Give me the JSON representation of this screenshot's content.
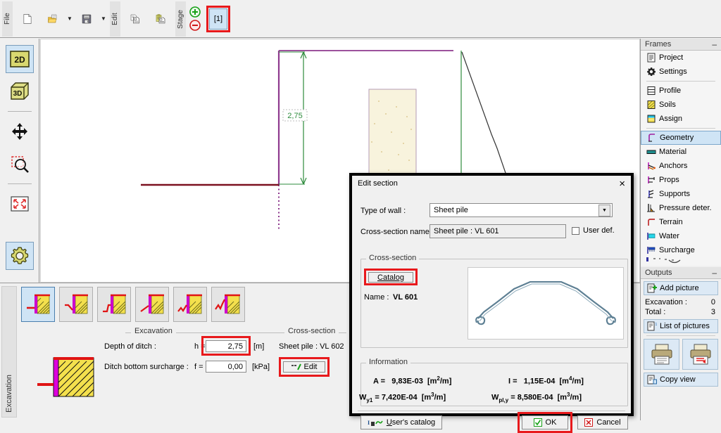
{
  "toolbar": {
    "groups": [
      {
        "label": "File",
        "items": [
          "new-file-icon",
          "open-folder-icon",
          "save-disk-icon"
        ]
      },
      {
        "label": "Edit",
        "items": [
          "copy-icon",
          "paste-icon"
        ]
      },
      {
        "label": "Stage",
        "items": [
          "add-stage-icon",
          "remove-stage-icon"
        ]
      }
    ],
    "file_label": "File",
    "edit_label": "Edit",
    "stage_label": "Stage",
    "stage_number": "[1]"
  },
  "left_tools": [
    {
      "name": "view-2d-button",
      "label": "2D",
      "selected": true
    },
    {
      "name": "view-3d-button",
      "label": "3D",
      "selected": false
    },
    {
      "name": "pan-button",
      "label": "",
      "selected": false
    },
    {
      "name": "zoom-window-button",
      "label": "",
      "selected": false
    },
    {
      "name": "zoom-fit-button",
      "label": "",
      "selected": false
    },
    {
      "name": "settings-button",
      "label": "",
      "selected": false
    }
  ],
  "canvas": {
    "dimension_label": "2,75"
  },
  "bottom_panel": {
    "tab_label": "Excavation",
    "shape_count": 6,
    "selected_shape_index": 0,
    "excavation_legend": "Excavation",
    "crosssection_legend": "Cross-section",
    "depth_label": "Depth of ditch :",
    "depth_symbol": "h =",
    "depth_value": "2,75",
    "depth_unit": "[m]",
    "surcharge_label": "Ditch bottom surcharge :",
    "surcharge_symbol": "f =",
    "surcharge_value": "0,00",
    "surcharge_unit": "[kPa]",
    "section_name": "Sheet pile : VL 602",
    "edit_button": "Edit"
  },
  "sidebar": {
    "frames_title": "Frames",
    "minimize_glyph": "–",
    "frames": [
      {
        "label": "Project",
        "icon": "project-icon",
        "selected": false
      },
      {
        "label": "Settings",
        "icon": "gear-icon",
        "selected": false
      },
      {
        "label": "Profile",
        "icon": "profile-icon",
        "selected": false
      },
      {
        "label": "Soils",
        "icon": "soils-icon",
        "selected": false
      },
      {
        "label": "Assign",
        "icon": "assign-icon",
        "selected": false
      },
      {
        "label": "Geometry",
        "icon": "geometry-icon",
        "selected": true
      },
      {
        "label": "Material",
        "icon": "material-icon",
        "selected": false
      },
      {
        "label": "Anchors",
        "icon": "anchors-icon",
        "selected": false
      },
      {
        "label": "Props",
        "icon": "props-icon",
        "selected": false
      },
      {
        "label": "Supports",
        "icon": "supports-icon",
        "selected": false
      },
      {
        "label": "Pressure deter.",
        "icon": "pressure-icon",
        "selected": false
      },
      {
        "label": "Terrain",
        "icon": "terrain-icon",
        "selected": false
      },
      {
        "label": "Water",
        "icon": "water-icon",
        "selected": false
      },
      {
        "label": "Surcharge",
        "icon": "surcharge-icon",
        "selected": false
      }
    ],
    "outputs_title": "Outputs",
    "add_picture": "Add picture",
    "excavation_label": "Excavation :",
    "excavation_count": "0",
    "total_label": "Total :",
    "total_count": "3",
    "list_of_pictures": "List of pictures",
    "copy_view": "Copy view"
  },
  "dialog": {
    "title": "Edit section",
    "close_glyph": "×",
    "type_of_wall_label": "Type of wall :",
    "type_of_wall_value": "Sheet pile",
    "cross_section_name_label": "Cross-section name :",
    "cross_section_name_value": "Sheet pile : VL 601",
    "user_def_label": "User def.",
    "user_def_checked": false,
    "cross_section_legend": "Cross-section",
    "catalog_button": "Catalog",
    "name_label": "Name :",
    "name_value": "VL 601",
    "information_legend": "Information",
    "info": [
      {
        "symbol": "A",
        "sub": "",
        "value": "9,83E-03",
        "unit_base": "m",
        "unit_exp": "2",
        "unit_den": "/m"
      },
      {
        "symbol": "I",
        "sub": "",
        "value": "1,15E-04",
        "unit_base": "m",
        "unit_exp": "4",
        "unit_den": "/m"
      },
      {
        "symbol": "W",
        "sub": "y1",
        "value": "7,420E-04",
        "unit_base": "m",
        "unit_exp": "3",
        "unit_den": "/m"
      },
      {
        "symbol": "W",
        "sub": "pl,y",
        "value": "8,580E-04",
        "unit_base": "m",
        "unit_exp": "3",
        "unit_den": "/m"
      }
    ],
    "info_a_label": "A =",
    "info_a_value": "9,83E-03",
    "info_i_label": "I =",
    "info_i_value": "1,15E-04",
    "info_wy1_value": "7,420E-04",
    "info_wply_value": "8,580E-04",
    "users_catalog_button": "User's catalog",
    "ok_button": "OK",
    "cancel_button": "Cancel"
  },
  "colors": {
    "highlight_red": "#e8191c",
    "selection_blue": "#cfe4f5",
    "wall_purple": "#8e3a8e",
    "dimension_green": "#2e8b3d",
    "terrain_dark_red": "#7b1020",
    "soil_beige": "#f7f2dc",
    "soil_green": "#d9ecd2",
    "steel_blue": "#5d7f93"
  }
}
